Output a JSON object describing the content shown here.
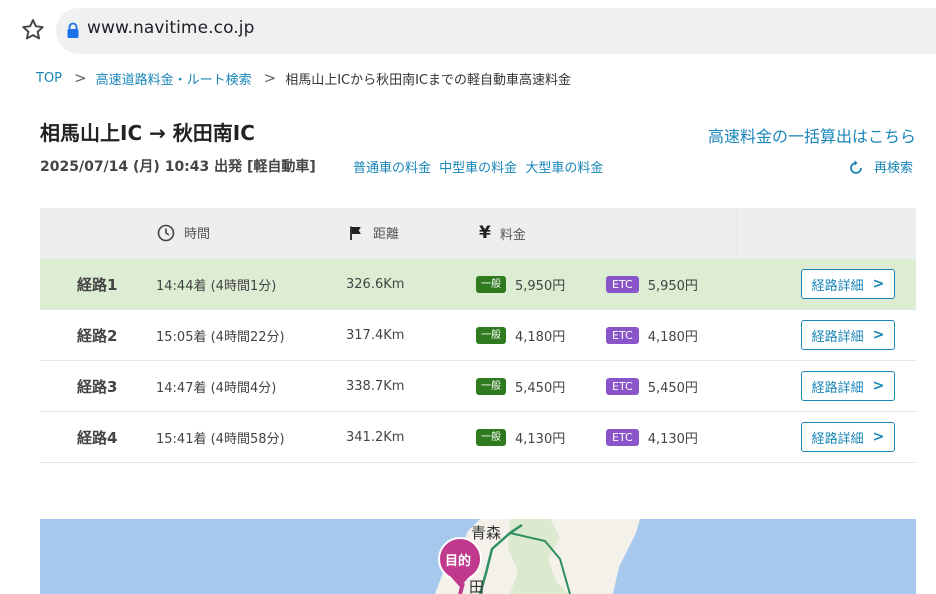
{
  "browser": {
    "url": "www.navitime.co.jp"
  },
  "breadcrumb": {
    "top": "TOP",
    "parent": "高速道路料金・ルート検索",
    "current": "相馬山上ICから秋田南ICまでの軽自動車高速料金"
  },
  "header": {
    "title": "相馬山上IC → 秋田南IC",
    "bulk_link": "高速料金の一括算出はこちら",
    "departure": "2025/07/14 (月) 10:43 出発  [軽自動車]",
    "vehicle_links": [
      "普通車の料金",
      "中型車の料金",
      "大型車の料金"
    ],
    "research_label": "再検索"
  },
  "table": {
    "headers": {
      "time": "時間",
      "distance": "距離",
      "fee": "料金"
    },
    "badge_general": "一般",
    "badge_etc": "ETC",
    "detail_label": "経路詳細",
    "rows": [
      {
        "name": "経路1",
        "time": "14:44着 (4時間1分)",
        "distance": "326.6Km",
        "general": "5,950円",
        "etc": "5,950円"
      },
      {
        "name": "経路2",
        "time": "15:05着 (4時間22分)",
        "distance": "317.4Km",
        "general": "4,180円",
        "etc": "4,180円"
      },
      {
        "name": "経路3",
        "time": "14:47着 (4時間4分)",
        "distance": "338.7Km",
        "general": "5,450円",
        "etc": "5,450円"
      },
      {
        "name": "経路4",
        "time": "15:41着 (4時間58分)",
        "distance": "341.2Km",
        "general": "4,130円",
        "etc": "4,130円"
      }
    ]
  },
  "map": {
    "place_label": "青森",
    "place_label_partial": "田",
    "destination_pin": "目的"
  },
  "colors": {
    "link": "#1a86b8",
    "active_row": "#dcedd3",
    "badge_general": "#2f7a1f",
    "badge_etc": "#8a55c9",
    "pin": "#c0398c",
    "sea": "#a6c8ec"
  }
}
